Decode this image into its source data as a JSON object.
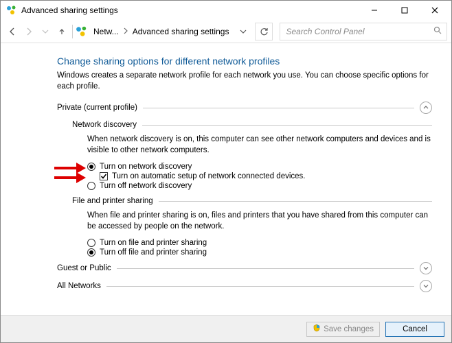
{
  "window": {
    "title": "Advanced sharing settings"
  },
  "breadcrumb": {
    "root": "Netw...",
    "current": "Advanced sharing settings"
  },
  "search": {
    "placeholder": "Search Control Panel"
  },
  "page": {
    "heading": "Change sharing options for different network profiles",
    "subtext": "Windows creates a separate network profile for each network you use. You can choose specific options for each profile."
  },
  "sections": {
    "private": {
      "label": "Private (current profile)",
      "network_discovery": {
        "title": "Network discovery",
        "desc": "When network discovery is on, this computer can see other network computers and devices and is visible to other network computers.",
        "opt_on": "Turn on network discovery",
        "opt_auto": "Turn on automatic setup of network connected devices.",
        "opt_off": "Turn off network discovery"
      },
      "file_printer": {
        "title": "File and printer sharing",
        "desc": "When file and printer sharing is on, files and printers that you have shared from this computer can be accessed by people on the network.",
        "opt_on": "Turn on file and printer sharing",
        "opt_off": "Turn off file and printer sharing"
      }
    },
    "guest": {
      "label": "Guest or Public"
    },
    "all": {
      "label": "All Networks"
    }
  },
  "footer": {
    "save": "Save changes",
    "cancel": "Cancel"
  }
}
